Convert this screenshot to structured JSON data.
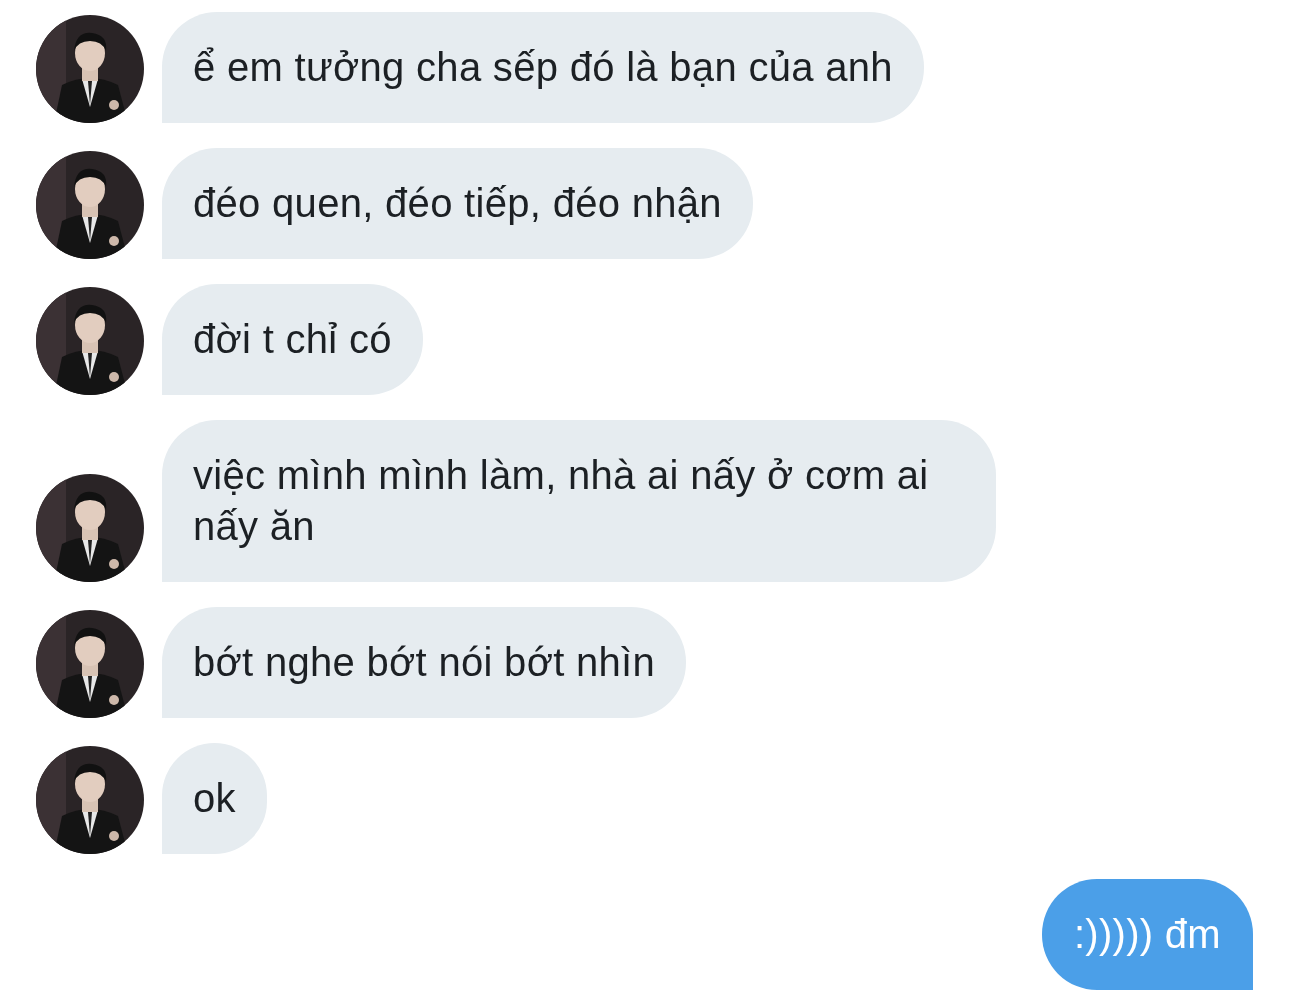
{
  "messages": [
    {
      "kind": "received",
      "text": "ể em tưởng cha sếp đó là bạn của anh"
    },
    {
      "kind": "received",
      "text": "đéo quen, đéo tiếp, đéo nhận"
    },
    {
      "kind": "received",
      "text": "đời t chỉ có"
    },
    {
      "kind": "received",
      "text": "việc mình mình làm, nhà ai nấy ở cơm ai nấy ăn"
    },
    {
      "kind": "received",
      "text": "bớt nghe bớt nói bớt nhìn"
    },
    {
      "kind": "received",
      "text": "ok"
    },
    {
      "kind": "sent",
      "text": ":))))) đm"
    }
  ]
}
